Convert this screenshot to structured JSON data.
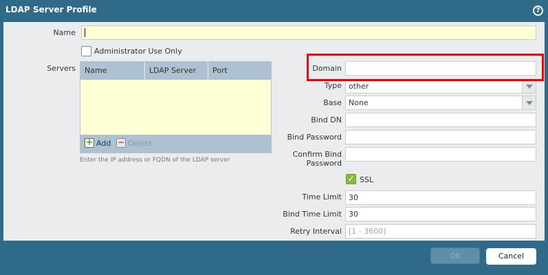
{
  "dialog": {
    "title": "LDAP Server Profile",
    "help_icon": "help-icon"
  },
  "form": {
    "name_label": "Name",
    "name_value": "",
    "admin_only_label": "Administrator Use Only",
    "admin_only_checked": false,
    "servers_label": "Servers",
    "servers_columns": [
      "Name",
      "LDAP Server",
      "Port"
    ],
    "servers_rows": [],
    "add_label": "Add",
    "delete_label": "Delete",
    "servers_hint": "Enter the IP address or FQDN of the LDAP server",
    "domain_label": "Domain",
    "domain_value": "",
    "type_label": "Type",
    "type_value": "other",
    "base_label": "Base",
    "base_value": "None",
    "bind_dn_label": "Bind DN",
    "bind_dn_value": "",
    "bind_password_label": "Bind Password",
    "confirm_bind_password_label_1": "Confirm Bind",
    "confirm_bind_password_label_2": "Password",
    "ssl_label": "SSL",
    "ssl_checked": true,
    "time_limit_label": "Time Limit",
    "time_limit_value": "30",
    "bind_time_limit_label": "Bind Time Limit",
    "bind_time_limit_value": "30",
    "retry_interval_label": "Retry Interval",
    "retry_interval_placeholder": "[1 - 3600]"
  },
  "footer": {
    "ok_label": "OK",
    "cancel_label": "Cancel"
  },
  "colors": {
    "highlight": "#e8000a",
    "header": "#2f6a88"
  }
}
